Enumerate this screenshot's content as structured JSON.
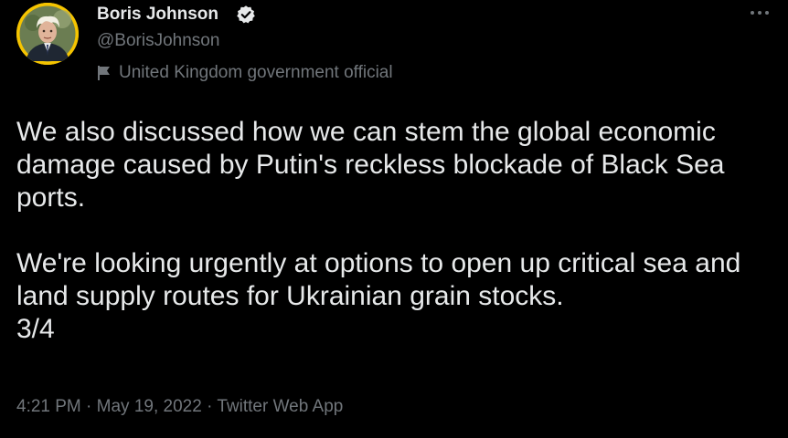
{
  "author": {
    "display_name": "Boris Johnson",
    "handle": "@BorisJohnson",
    "label": "United Kingdom government official",
    "verified": true,
    "avatar_icon": "avatar-photo",
    "verified_icon": "verified-badge-icon",
    "label_icon": "flag-icon"
  },
  "tweet": {
    "paragraphs": [
      "We also discussed how we can stem the global economic damage caused by Putin's reckless blockade of Black Sea ports.",
      "We're looking urgently at options to open up critical sea and land supply routes for Ukrainian grain stocks."
    ],
    "thread_counter": "3/4"
  },
  "meta": {
    "time": "4:21 PM",
    "separator": "·",
    "date": "May 19, 2022",
    "source": "Twitter Web App"
  },
  "menu": {
    "icon": "more-options-icon"
  },
  "colors": {
    "background": "#000000",
    "primary_text": "#e7e9ea",
    "secondary_text": "#71767b",
    "avatar_ring": "#f5c400",
    "verified_badge": "#e7e9ea"
  }
}
